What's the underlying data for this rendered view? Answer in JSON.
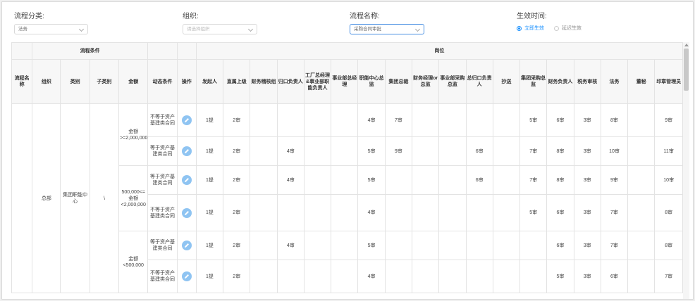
{
  "filters": {
    "category": {
      "label": "流程分类:",
      "value": "法务"
    },
    "org": {
      "label": "组织:",
      "placeholder": "请选择组织"
    },
    "process_name": {
      "label": "流程名称:",
      "value": "采购合同审批"
    },
    "effective": {
      "label": "生效时间:",
      "options": [
        "立即生效",
        "延迟生效"
      ],
      "selected": "立即生效"
    }
  },
  "table": {
    "group_headers": {
      "conditions": "流程条件",
      "positions": "岗位"
    },
    "columns": {
      "process_name": "流程名称",
      "org": "组织",
      "type": "类别",
      "subtype": "子类别",
      "amount": "金额",
      "dynamic": "动态条件",
      "action": "操作",
      "positions": [
        "发起人",
        "直属上级",
        "财务稽核组",
        "归口负责人",
        "工厂总经理&事业部职能负责人",
        "事业部总经理",
        "职能中心总监",
        "集团总裁",
        "财务经理or总监",
        "事业部采购总监",
        "总归口负责人",
        "抄送",
        "集团采购总监",
        "财务负责人",
        "税务审核",
        "法务",
        "董秘",
        "印章管理员"
      ]
    },
    "merged": {
      "org": "总部",
      "type": "集团职能中心",
      "subtype": "\\"
    },
    "amount_groups": [
      "金额>=2,000,000",
      "500,000<=金额<2,000,000",
      "金额<500,000"
    ],
    "rows": [
      {
        "dynamic": "不等于资产基建类合同",
        "cells": [
          "1提",
          "2审",
          "",
          "",
          "",
          "",
          "4审",
          "7审",
          "",
          "",
          "",
          "",
          "5审",
          "6审",
          "3审",
          "8审",
          "",
          "9审"
        ]
      },
      {
        "dynamic": "等于资产基建类合同",
        "cells": [
          "1提",
          "2审",
          "",
          "4审",
          "",
          "",
          "5审",
          "9审",
          "",
          "",
          "6审",
          "",
          "7审",
          "8审",
          "3审",
          "10审",
          "",
          "11审"
        ]
      },
      {
        "dynamic": "等于资产基建类合同",
        "cells": [
          "1提",
          "2审",
          "",
          "4审",
          "",
          "",
          "5审",
          "",
          "",
          "",
          "6审",
          "",
          "7审",
          "8审",
          "3审",
          "9审",
          "",
          "10审"
        ]
      },
      {
        "dynamic": "不等于资产基建类合同",
        "cells": [
          "1提",
          "2审",
          "",
          "",
          "",
          "",
          "4审",
          "",
          "",
          "",
          "",
          "",
          "5审",
          "6审",
          "3审",
          "7审",
          "",
          "8审"
        ]
      },
      {
        "dynamic": "等于资产基建类合同",
        "cells": [
          "1提",
          "2审",
          "",
          "4审",
          "",
          "",
          "5审",
          "",
          "",
          "",
          "",
          "",
          "",
          "6审",
          "3审",
          "7审",
          "",
          "8审"
        ]
      },
      {
        "dynamic": "不等于资产基建类合同",
        "cells": [
          "1提",
          "2审",
          "",
          "",
          "",
          "",
          "4审",
          "",
          "",
          "",
          "",
          "",
          "",
          "5审",
          "3审",
          "6审",
          "",
          "7审"
        ]
      }
    ]
  },
  "colors": {
    "accent": "#1890ff",
    "edit_button": "#8fc4f2",
    "header_bg": "#f7f7f7",
    "border": "#e3e3e3"
  },
  "icons": {
    "edit": "pencil-edit-icon",
    "dropdown": "chevron-down-icon"
  }
}
